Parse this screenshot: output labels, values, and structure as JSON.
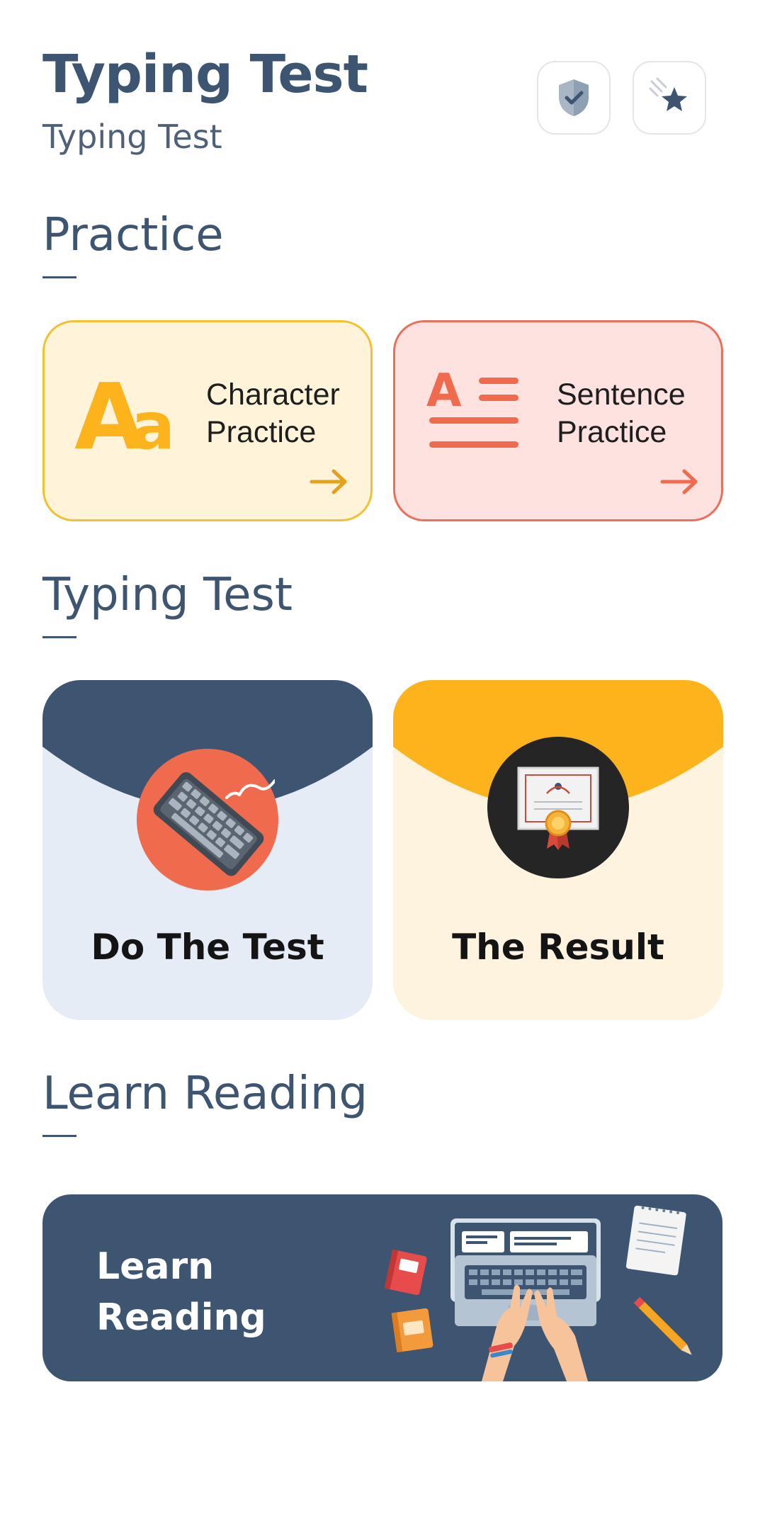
{
  "header": {
    "title": "Typing Test",
    "subtitle": "Typing Test",
    "icons": [
      "shield-check-icon",
      "shooting-star-icon"
    ]
  },
  "sections": {
    "practice": {
      "title": "Practice",
      "cards": [
        {
          "line1": "Character",
          "line2": "Practice",
          "icon": "aa-letters-icon",
          "accent": "#f2c12f"
        },
        {
          "line1": "Sentence",
          "line2": "Practice",
          "icon": "text-lines-icon",
          "accent": "#e9705a"
        }
      ]
    },
    "typing_test": {
      "title": "Typing Test",
      "cards": [
        {
          "label": "Do The Test",
          "icon": "keyboard-icon",
          "accent": "#3d5570"
        },
        {
          "label": "The Result",
          "icon": "certificate-icon",
          "accent": "#fcb31c"
        }
      ]
    },
    "learn_reading": {
      "title": "Learn Reading",
      "banner": {
        "line1": "Learn",
        "line2": "Reading",
        "illustration": "laptop-typing-illustration"
      }
    }
  },
  "colors": {
    "primary": "#3d5570",
    "yellow": "#fcb31c",
    "coral": "#f06a4d"
  }
}
